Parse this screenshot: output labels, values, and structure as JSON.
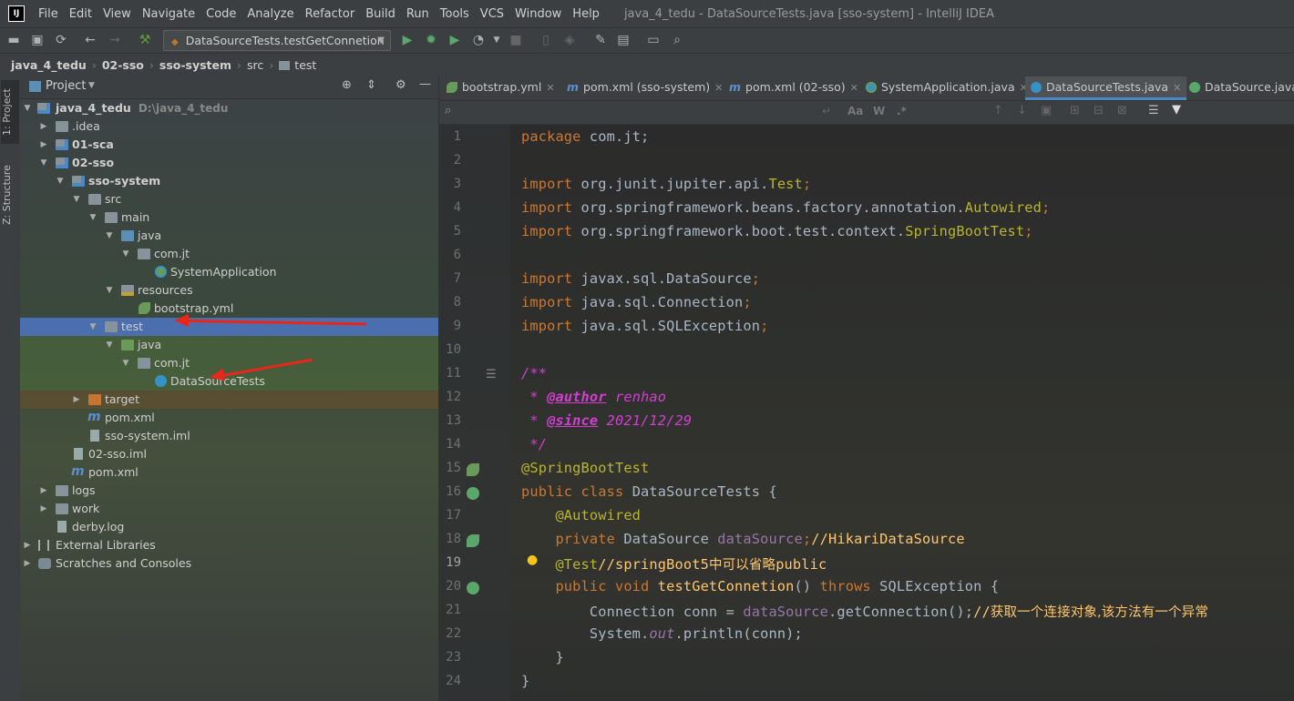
{
  "menubar": {
    "logo": "IJ",
    "items": [
      "File",
      "Edit",
      "View",
      "Navigate",
      "Code",
      "Analyze",
      "Refactor",
      "Build",
      "Run",
      "Tools",
      "VCS",
      "Window",
      "Help"
    ],
    "window_title": "java_4_tedu - DataSourceTests.java [sso-system] - IntelliJ IDEA"
  },
  "toolbar": {
    "run_config": "DataSourceTests.testGetConnetion"
  },
  "breadcrumb": [
    "java_4_tedu",
    "02-sso",
    "sso-system",
    "src",
    "test"
  ],
  "left_stripe": {
    "project_tab": "1: Project",
    "structure_tab": "Z: Structure"
  },
  "project_panel": {
    "title": "Project",
    "tree": [
      {
        "label": "java_4_tedu",
        "path": "D:\\java_4_tedu"
      },
      {
        "label": ".idea"
      },
      {
        "label": "01-sca"
      },
      {
        "label": "02-sso"
      },
      {
        "label": "sso-system"
      },
      {
        "label": "src"
      },
      {
        "label": "main"
      },
      {
        "label": "java"
      },
      {
        "label": "com.jt"
      },
      {
        "label": "SystemApplication"
      },
      {
        "label": "resources"
      },
      {
        "label": "bootstrap.yml"
      },
      {
        "label": "test"
      },
      {
        "label": "java"
      },
      {
        "label": "com.jt"
      },
      {
        "label": "DataSourceTests"
      },
      {
        "label": "target"
      },
      {
        "label": "pom.xml"
      },
      {
        "label": "sso-system.iml"
      },
      {
        "label": "02-sso.iml"
      },
      {
        "label": "pom.xml"
      },
      {
        "label": "logs"
      },
      {
        "label": "work"
      },
      {
        "label": "derby.log"
      },
      {
        "label": "External Libraries"
      },
      {
        "label": "Scratches and Consoles"
      }
    ]
  },
  "editor_tabs": [
    {
      "label": "bootstrap.yml"
    },
    {
      "label": "pom.xml (sso-system)"
    },
    {
      "label": "pom.xml (02-sso)"
    },
    {
      "label": "SystemApplication.java"
    },
    {
      "label": "DataSourceTests.java"
    },
    {
      "label": "DataSource.java"
    }
  ],
  "search": {
    "aa": "Aa",
    "w": "W",
    ".*": ".*"
  },
  "code": {
    "line_numbers": [
      "1",
      "2",
      "3",
      "4",
      "5",
      "6",
      "7",
      "8",
      "9",
      "10",
      "11",
      "12",
      "13",
      "14",
      "15",
      "16",
      "17",
      "18",
      "19",
      "20",
      "21",
      "22",
      "23",
      "24"
    ],
    "l1a": "package ",
    "l1b": "com.jt;",
    "imp": "import ",
    "l3a": "org.junit.jupiter.api.",
    "l3b": "Test",
    "l4a": "org.springframework.beans.factory.annotation.",
    "l4b": "Autowired",
    "l5a": "org.springframework.boot.test.context.",
    "l5b": "SpringBootTest",
    "l7": "javax.sql.DataSource",
    "l8": "java.sql.Connection",
    "l9": "java.sql.SQLException",
    "semi": ";",
    "l11": "/**",
    "l12a": " * ",
    "l12b": "@author",
    "l12c": " renhao",
    "l13a": " * ",
    "l13b": "@since",
    "l13c": " 2021/12/29",
    "l14": " */",
    "l15": "@SpringBootTest",
    "l16a": "public class ",
    "l16b": "DataSourceTests {",
    "l17": "    @Autowired",
    "l18a": "    private ",
    "l18b": "DataSource ",
    "l18c": "dataSource",
    "l18d": ";",
    "l18e": "//HikariDataSource",
    "l19a": "    @Test",
    "l19b": "//springBoot5",
    "l19c": "中可以省略",
    "l19d": "public",
    "l20a": "    public void ",
    "l20b": "testGetConnetion",
    "l20c": "() ",
    "l20d": "throws ",
    "l20e": "SQLException {",
    "l21a": "        Connection conn = ",
    "l21b": "dataSource",
    "l21c": ".getConnection();",
    "l21d": "//",
    "l21e": "获取一个连接对象,该方法有一个异常",
    "l22a": "        System.",
    "l22b": "out",
    "l22c": ".println(conn);",
    "l23": "    }",
    "l24": "}"
  },
  "colors": {
    "selection": "#4b6eaf",
    "keyword": "#cc7832",
    "annotation": "#bbb529",
    "doc": "#d43dd4",
    "field": "#9876aa",
    "arrow": "#e8271b"
  }
}
